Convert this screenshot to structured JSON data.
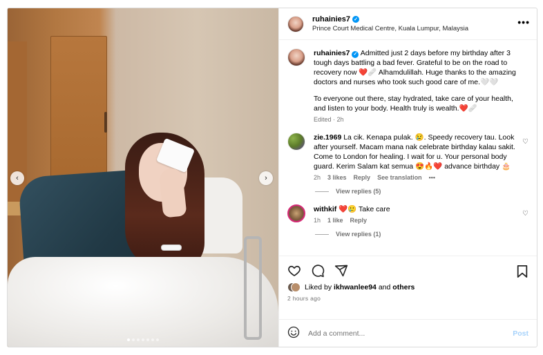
{
  "header": {
    "username": "ruhainies7",
    "location": "Prince Court Medical Centre, Kuala Lumpur, Malaysia",
    "more_label": "•••"
  },
  "photo": {
    "prev_label": "‹",
    "next_label": "›",
    "dots_count": 7,
    "active_dot": 0
  },
  "caption": {
    "username": "ruhainies7",
    "text_1": "Admitted just 2 days before my birthday after 3 tough days battling a bad fever. Grateful to be on the road to recovery now ❤️🩹 Alhamdulillah. Huge thanks to the amazing doctors and nurses who took such good care of me.🤍🤍",
    "text_2": "To everyone out there, stay hydrated, take care of your health, and listen to your body. Health truly is wealth.❤️🩹",
    "meta": "Edited · 2h"
  },
  "comments": [
    {
      "username": "zie.1969",
      "text": "La cik. Kenapa pulak. 😢. Speedy recovery tau. Look after yourself. Macam mana nak celebrate birthday kalau sakit. Come to London for healing. I wait for u. Your personal body guard. Kerim Salam kat semua 😍🔥❤️ advance birthday 🎂",
      "time": "2h",
      "likes": "3 likes",
      "reply": "Reply",
      "translate": "See translation",
      "more": "•••",
      "view_replies": "View replies (5)"
    },
    {
      "username": "withkif",
      "text": "❤️🥲 Take care",
      "time": "1h",
      "likes": "1 like",
      "reply": "Reply",
      "view_replies": "View replies (1)"
    }
  ],
  "actions": {
    "liked_by_prefix": "Liked by",
    "liked_by_user": "ikhwanlee94",
    "liked_by_and": "and",
    "liked_by_others": "others",
    "time_ago": "2 hours ago"
  },
  "add_comment": {
    "placeholder": "Add a comment...",
    "post_label": "Post"
  },
  "colors": {
    "verified": "#0095f6",
    "post_disabled": "#a6d2fb",
    "muted_text": "#737373"
  }
}
